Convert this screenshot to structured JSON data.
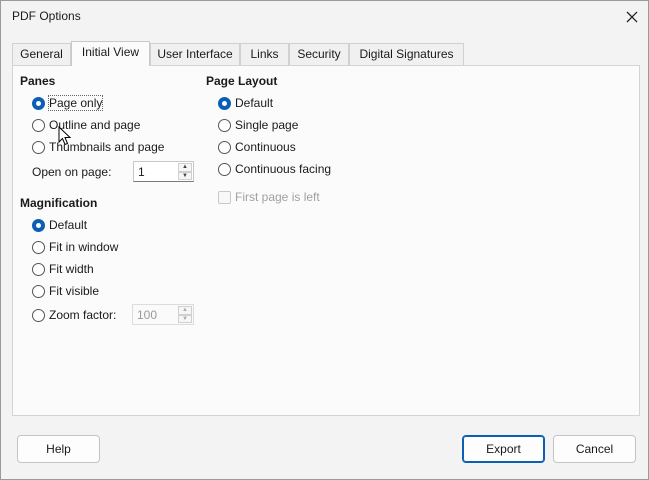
{
  "window": {
    "title": "PDF Options"
  },
  "tabs": [
    {
      "label": "General",
      "active": false
    },
    {
      "label": "Initial View",
      "active": true
    },
    {
      "label": "User Interface",
      "active": false
    },
    {
      "label": "Links",
      "active": false
    },
    {
      "label": "Security",
      "active": false
    },
    {
      "label": "Digital Signatures",
      "active": false
    }
  ],
  "panes": {
    "heading": "Panes",
    "options": [
      {
        "label": "Page only",
        "checked": true
      },
      {
        "label": "Outline and page",
        "checked": false
      },
      {
        "label": "Thumbnails and page",
        "checked": false
      }
    ],
    "open_on_page_label": "Open on page:",
    "open_on_page_value": "1"
  },
  "magnification": {
    "heading": "Magnification",
    "options": [
      {
        "label": "Default",
        "checked": true
      },
      {
        "label": "Fit in window",
        "checked": false
      },
      {
        "label": "Fit width",
        "checked": false
      },
      {
        "label": "Fit visible",
        "checked": false
      },
      {
        "label": "Zoom factor:",
        "checked": false
      }
    ],
    "zoom_value": "100"
  },
  "page_layout": {
    "heading": "Page Layout",
    "options": [
      {
        "label": "Default",
        "checked": true
      },
      {
        "label": "Single page",
        "checked": false
      },
      {
        "label": "Continuous",
        "checked": false
      },
      {
        "label": "Continuous facing",
        "checked": false
      }
    ],
    "first_page_left_label": "First page is left",
    "first_page_left_enabled": false
  },
  "buttons": {
    "help": "Help",
    "export": "Export",
    "cancel": "Cancel"
  },
  "colors": {
    "accent": "#0a5fb4"
  },
  "icons": {
    "close": "close-icon",
    "cursor": "mouse-pointer-icon"
  }
}
